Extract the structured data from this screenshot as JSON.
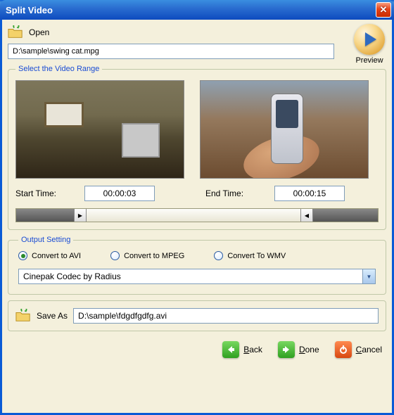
{
  "window": {
    "title": "Split Video"
  },
  "open": {
    "label": "Open",
    "path": "D:\\sample\\swing cat.mpg",
    "preview_label": "Preview"
  },
  "range": {
    "legend": "Select the Video Range",
    "start_label": "Start Time:",
    "start_value": "00:00:03",
    "end_label": "End Time:",
    "end_value": "00:00:15"
  },
  "output": {
    "legend": "Output Setting",
    "options": {
      "avi": "Convert to AVI",
      "mpeg": "Convert to MPEG",
      "wmv": "Convert To WMV"
    },
    "selected": "avi",
    "codec": "Cinepak Codec by Radius"
  },
  "save": {
    "label": "Save As",
    "path": "D:\\sample\\fdgdfgdfg.avi"
  },
  "actions": {
    "back": "Back",
    "done": "Done",
    "cancel": "Cancel"
  }
}
